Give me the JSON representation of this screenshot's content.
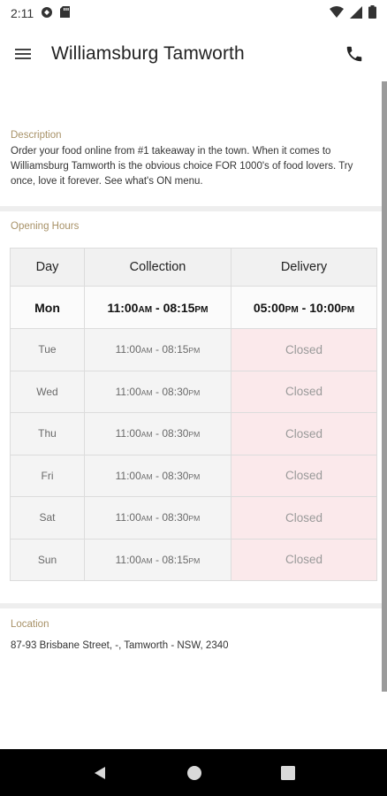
{
  "status_bar": {
    "time": "2:11"
  },
  "app_bar": {
    "title": "Williamsburg Tamworth"
  },
  "description": {
    "label": "Description",
    "text": "Order your food online from #1 takeaway in the town. When it comes to Williamsburg Tamworth is the obvious choice FOR 1000's of food lovers. Try once, love it forever. See what's ON menu."
  },
  "opening_hours": {
    "label": "Opening Hours",
    "headers": [
      "Day",
      "Collection",
      "Delivery"
    ],
    "rows": [
      {
        "day": "Mon",
        "collection": [
          "11:00",
          "AM",
          " - 08:15",
          "PM"
        ],
        "delivery": [
          "05:00",
          "PM",
          " - 10:00",
          "PM"
        ]
      },
      {
        "day": "Tue",
        "collection": [
          "11:00",
          "AM",
          " - 08:15",
          "PM"
        ],
        "delivery": "Closed"
      },
      {
        "day": "Wed",
        "collection": [
          "11:00",
          "AM",
          " - 08:30",
          "PM"
        ],
        "delivery": "Closed"
      },
      {
        "day": "Thu",
        "collection": [
          "11:00",
          "AM",
          " - 08:30",
          "PM"
        ],
        "delivery": "Closed"
      },
      {
        "day": "Fri",
        "collection": [
          "11:00",
          "AM",
          " - 08:30",
          "PM"
        ],
        "delivery": "Closed"
      },
      {
        "day": "Sat",
        "collection": [
          "11:00",
          "AM",
          " - 08:30",
          "PM"
        ],
        "delivery": "Closed"
      },
      {
        "day": "Sun",
        "collection": [
          "11:00",
          "AM",
          " - 08:15",
          "PM"
        ],
        "delivery": "Closed"
      }
    ]
  },
  "location": {
    "label": "Location",
    "address": "87-93 Brisbane Street, -, Tamworth - NSW, 2340"
  },
  "colors": {
    "accent_label": "#a89268",
    "closed_bg": "#fbe9eb"
  }
}
